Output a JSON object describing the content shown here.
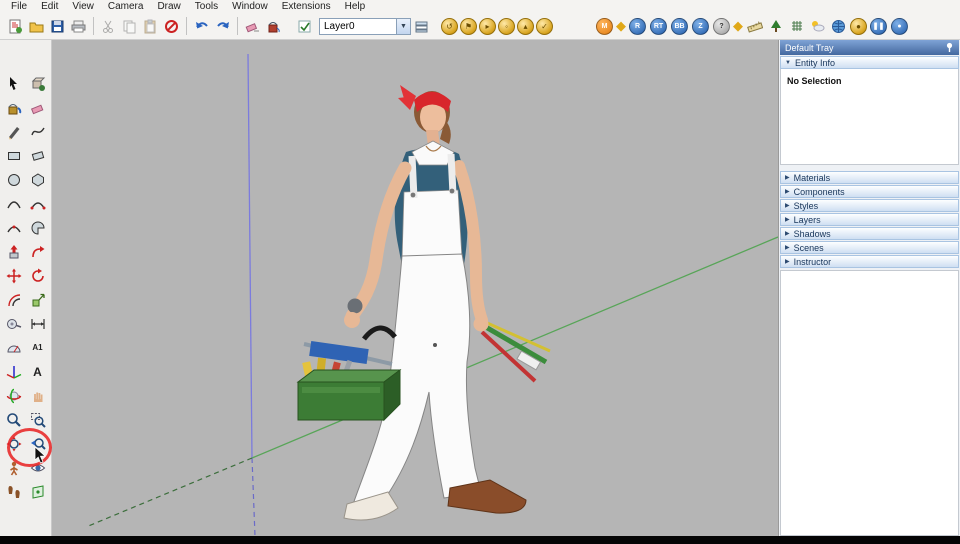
{
  "menubar": {
    "items": [
      "File",
      "Edit",
      "View",
      "Camera",
      "Draw",
      "Tools",
      "Window",
      "Extensions",
      "Help"
    ]
  },
  "toolbar": {
    "layer_value": "Layer0",
    "badge_m": "M",
    "badge_r": "R",
    "badge_rt": "RT",
    "badge_bb": "BB",
    "badge_z": "Z",
    "badge_q": "?"
  },
  "left_toolbar": {
    "text_tool_label": "A1",
    "threed_text_label": "A",
    "tools": [
      "Select",
      "Make Component",
      "Paint Bucket",
      "Eraser",
      "Line",
      "Freehand",
      "Rectangle",
      "Rotated Rectangle",
      "Circle",
      "Polygon",
      "Arc",
      "2 Point Arc",
      "3 Point Arc",
      "Pie",
      "Push/Pull",
      "Follow Me",
      "Move",
      "Rotate",
      "Offset",
      "Scale",
      "Tape Measure",
      "Dimension",
      "Protractor",
      "Text",
      "Axes",
      "3D Text",
      "Orbit",
      "Pan",
      "Zoom",
      "Zoom Window",
      "Zoom Extents",
      "Previous",
      "Position Camera",
      "Look Around",
      "Walk",
      "Section Plane"
    ]
  },
  "tray": {
    "title": "Default Tray",
    "entity_info_label": "Entity Info",
    "entity_info_status": "No Selection",
    "sections": [
      {
        "label": "Materials"
      },
      {
        "label": "Components"
      },
      {
        "label": "Styles"
      },
      {
        "label": "Layers"
      },
      {
        "label": "Shadows"
      },
      {
        "label": "Scenes"
      },
      {
        "label": "Instructor"
      }
    ]
  },
  "canvas": {
    "axis_blue": "#7b7bde",
    "axis_green": "#58a558",
    "annotation_color": "#e82020"
  }
}
